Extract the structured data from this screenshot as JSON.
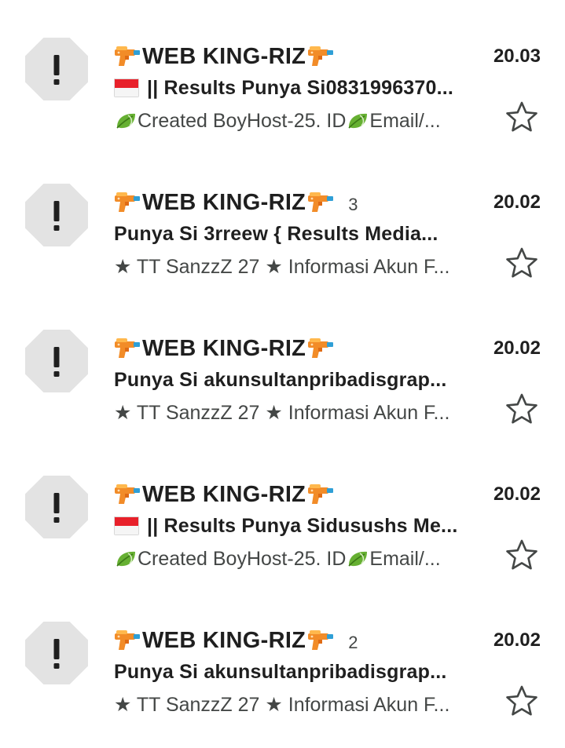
{
  "emails": [
    {
      "sender": "WEB KING-RIZ",
      "count": "",
      "time": "20.03",
      "subject": "|| Results Punya Si0831996370...",
      "has_flag": true,
      "snippet_a": "Created BoyHost-25. ID",
      "snippet_b": " Email/...",
      "snippet_style": "leaf"
    },
    {
      "sender": "WEB KING-RIZ",
      "count": "3",
      "time": "20.02",
      "subject": "Punya Si 3rreew { Results Media...",
      "has_flag": false,
      "snippet_a": "★ TT SanzzZ 27 ★ Informasi Akun F...",
      "snippet_b": "",
      "snippet_style": "plain"
    },
    {
      "sender": "WEB KING-RIZ",
      "count": "",
      "time": "20.02",
      "subject": "Punya Si akunsultanpribadisgrap...",
      "has_flag": false,
      "snippet_a": "★ TT SanzzZ 27 ★ Informasi Akun F...",
      "snippet_b": "",
      "snippet_style": "plain"
    },
    {
      "sender": "WEB KING-RIZ",
      "count": "",
      "time": "20.02",
      "subject": "|| Results Punya Sidusushs Me...",
      "has_flag": true,
      "snippet_a": "Created BoyHost-25. ID",
      "snippet_b": " Email/...",
      "snippet_style": "leaf"
    },
    {
      "sender": "WEB KING-RIZ",
      "count": "2",
      "time": "20.02",
      "subject": "Punya Si akunsultanpribadisgrap...",
      "has_flag": false,
      "snippet_a": "★ TT SanzzZ 27 ★ Informasi Akun F...",
      "snippet_b": "",
      "snippet_style": "plain"
    }
  ],
  "icons": {
    "avatar": "warning-octagon-icon",
    "sender_decoration": "water-gun-icon",
    "subject_flag": "indonesia-flag-icon",
    "snippet_decoration": "leaf-icon",
    "star": "star-outline-icon"
  },
  "colors": {
    "avatar_bg": "#e3e3e3",
    "avatar_glyph": "#1f1f1f",
    "text_primary": "#1f1f1f",
    "text_secondary": "#444746",
    "star_outline": "#444746"
  }
}
